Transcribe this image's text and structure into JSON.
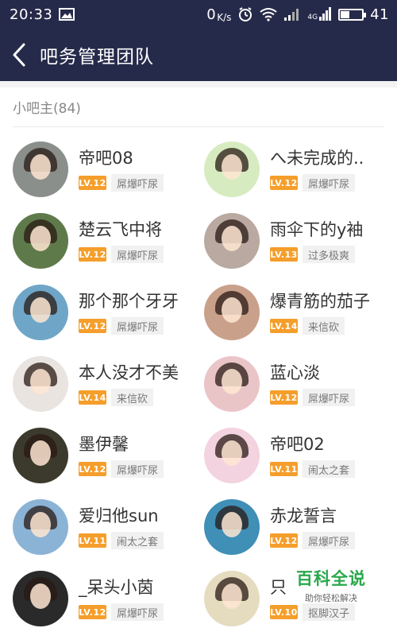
{
  "status_bar": {
    "time": "20:33",
    "network_speed": "0",
    "network_speed_unit": "K/s",
    "network_type": "4G",
    "battery_level": "41"
  },
  "nav": {
    "back_icon": "chevron-left-icon",
    "title": "吧务管理团队"
  },
  "section": {
    "title": "小吧主(84)"
  },
  "members": [
    {
      "name": "帝吧08",
      "level": "LV.12",
      "title": "屌爆吓尿",
      "avatar_color": "#8a8f8c"
    },
    {
      "name": "へ未完成的..",
      "level": "LV.12",
      "title": "屌爆吓尿",
      "avatar_color": "#d6ecc0"
    },
    {
      "name": "楚云飞中将",
      "level": "LV.12",
      "title": "屌爆吓尿",
      "avatar_color": "#5f7a4a"
    },
    {
      "name": "雨伞下的y袖",
      "level": "LV.13",
      "title": "过多极爽",
      "avatar_color": "#b9a9a0"
    },
    {
      "name": "那个那个牙牙",
      "level": "LV.12",
      "title": "屌爆吓尿",
      "avatar_color": "#6fa6c8"
    },
    {
      "name": "爆青筋的茄子",
      "level": "LV.14",
      "title": "来信砍",
      "avatar_color": "#c9a08a"
    },
    {
      "name": "本人没才不美",
      "level": "LV.14",
      "title": "来信砍",
      "avatar_color": "#e9e4e0"
    },
    {
      "name": "蓝心淡",
      "level": "LV.12",
      "title": "屌爆吓尿",
      "avatar_color": "#eac5c8"
    },
    {
      "name": "墨伊馨",
      "level": "LV.12",
      "title": "屌爆吓尿",
      "avatar_color": "#3c3a2c"
    },
    {
      "name": "帝吧02",
      "level": "LV.11",
      "title": "闹太之套",
      "avatar_color": "#f3d3e0"
    },
    {
      "name": "爱归他sun",
      "level": "LV.11",
      "title": "闹太之套",
      "avatar_color": "#8bb3d6"
    },
    {
      "name": "赤龙誓言",
      "level": "LV.12",
      "title": "屌爆吓尿",
      "avatar_color": "#3f8fb6"
    },
    {
      "name": "_呆头小茵",
      "level": "LV.12",
      "title": "屌爆吓尿",
      "avatar_color": "#2a2a2a"
    },
    {
      "name": "只",
      "level": "LV.10",
      "title": "抠脚汉子",
      "avatar_color": "#e5dcc0"
    }
  ],
  "watermark": {
    "title": "百科全说",
    "subtitle": "助你轻松解决"
  },
  "colors": {
    "header_bg": "#262a4a",
    "level_badge": "#f59e2b",
    "watermark_green": "#2aa84b"
  }
}
